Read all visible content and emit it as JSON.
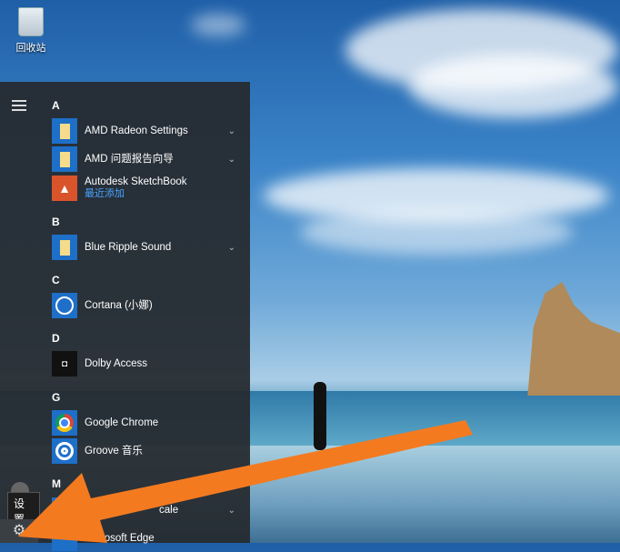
{
  "desktop": {
    "recycle_bin_label": "回收站"
  },
  "start_menu": {
    "sections": [
      {
        "letter": "A",
        "items": [
          {
            "label": "AMD Radeon Settings",
            "icon": "folder-icon",
            "expand": true
          },
          {
            "label": "AMD 问题报告向导",
            "icon": "folder-icon",
            "expand": true
          },
          {
            "label": "Autodesk SketchBook",
            "sub": "最近添加",
            "icon": "sketchbook-icon"
          }
        ]
      },
      {
        "letter": "B",
        "items": [
          {
            "label": "Blue Ripple Sound",
            "icon": "folder-icon",
            "expand": true
          }
        ]
      },
      {
        "letter": "C",
        "items": [
          {
            "label": "Cortana (小娜)",
            "icon": "cortana-icon"
          }
        ]
      },
      {
        "letter": "D",
        "items": [
          {
            "label": "Dolby Access",
            "icon": "dolby-icon"
          }
        ]
      },
      {
        "letter": "G",
        "items": [
          {
            "label": "Google Chrome",
            "icon": "chrome-icon"
          },
          {
            "label": "Groove 音乐",
            "icon": "groove-icon"
          }
        ]
      },
      {
        "letter": "M",
        "items": [
          {
            "label": "cale",
            "icon": "folder-icon",
            "expand": true
          },
          {
            "label": "Microsoft Edge",
            "icon": "edge-icon"
          }
        ]
      }
    ],
    "settings_tooltip": "设置",
    "dolby_glyph": "◘",
    "chevron": "⌄",
    "gear_glyph": "⚙"
  },
  "annotation": {
    "arrow_color": "#f47a20"
  }
}
